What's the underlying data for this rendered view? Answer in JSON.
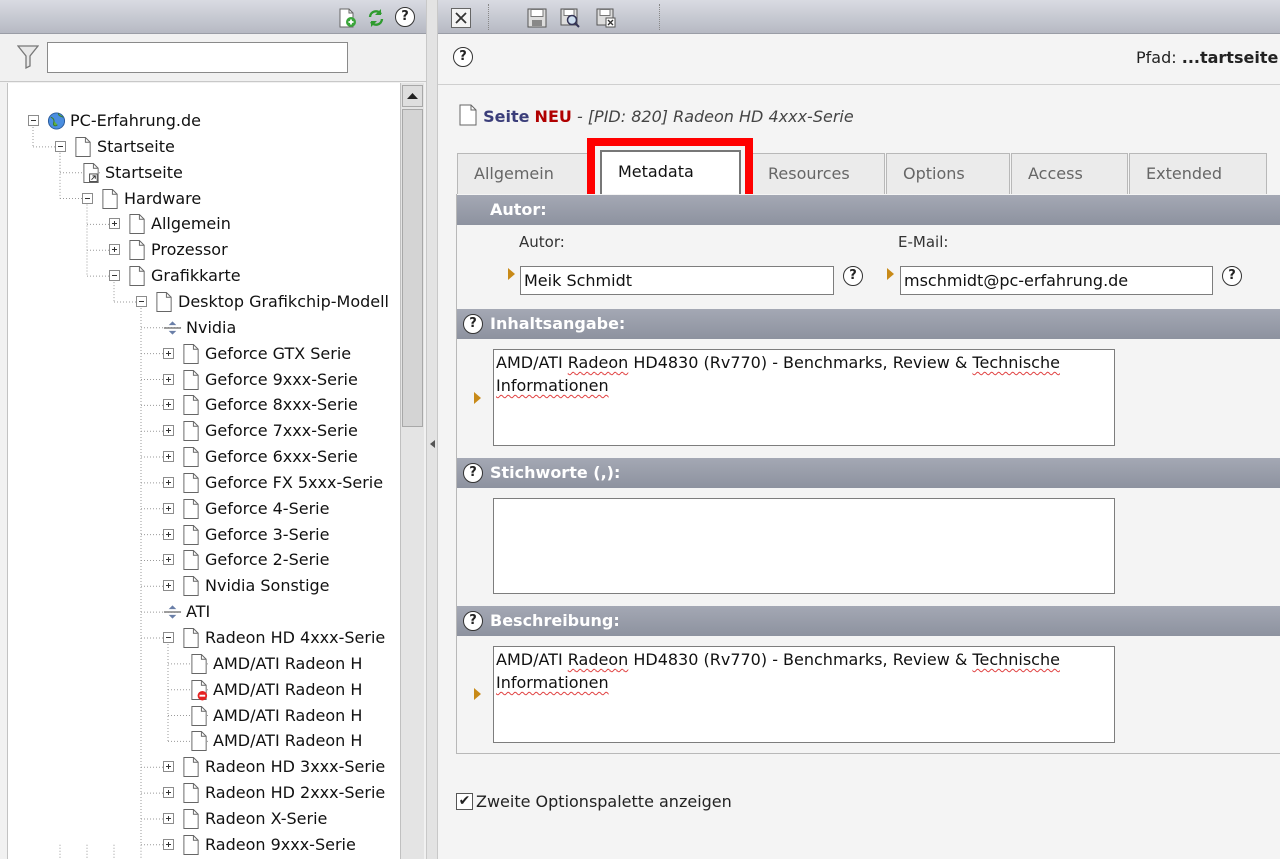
{
  "left_toolbar": {
    "icons": [
      "new-page-icon",
      "refresh-icon",
      "help-icon"
    ]
  },
  "filter": {
    "value": "",
    "placeholder": ""
  },
  "tree": [
    {
      "label": "PC-Erfahrung.de",
      "icon": "globe"
    },
    {
      "label": "Startseite",
      "icon": "page"
    },
    {
      "label": "Startseite",
      "icon": "link-page"
    },
    {
      "label": "Hardware",
      "icon": "page"
    },
    {
      "label": "Allgemein",
      "icon": "page"
    },
    {
      "label": "Prozessor",
      "icon": "page"
    },
    {
      "label": "Grafikkarte",
      "icon": "page"
    },
    {
      "label": "Desktop Grafikchip-Modell",
      "icon": "page"
    },
    {
      "label": "Nvidia",
      "icon": "separator"
    },
    {
      "label": "Geforce GTX Serie",
      "icon": "page"
    },
    {
      "label": "Geforce 9xxx-Serie",
      "icon": "page"
    },
    {
      "label": "Geforce 8xxx-Serie",
      "icon": "page"
    },
    {
      "label": "Geforce 7xxx-Serie",
      "icon": "page"
    },
    {
      "label": "Geforce 6xxx-Serie",
      "icon": "page"
    },
    {
      "label": "Geforce FX 5xxx-Serie",
      "icon": "page"
    },
    {
      "label": "Geforce 4-Serie",
      "icon": "page"
    },
    {
      "label": "Geforce 3-Serie",
      "icon": "page"
    },
    {
      "label": "Geforce 2-Serie",
      "icon": "page"
    },
    {
      "label": "Nvidia Sonstige",
      "icon": "page"
    },
    {
      "label": "ATI",
      "icon": "separator"
    },
    {
      "label": "Radeon HD 4xxx-Serie",
      "icon": "page"
    },
    {
      "label": "AMD/ATI Radeon H",
      "icon": "page"
    },
    {
      "label": "AMD/ATI Radeon H",
      "icon": "page-hidden"
    },
    {
      "label": "AMD/ATI Radeon H",
      "icon": "page"
    },
    {
      "label": "AMD/ATI Radeon H",
      "icon": "page"
    },
    {
      "label": "Radeon HD 3xxx-Serie",
      "icon": "page"
    },
    {
      "label": "Radeon HD 2xxx-Serie",
      "icon": "page"
    },
    {
      "label": "Radeon X-Serie",
      "icon": "page"
    },
    {
      "label": "Radeon 9xxx-Serie",
      "icon": "page"
    }
  ],
  "right_toolbar": {
    "icons": [
      "close-icon",
      "save-icon",
      "save-view-icon",
      "save-close-icon"
    ]
  },
  "pfad": {
    "label": "Pfad:",
    "value": "...tartseite"
  },
  "doc_title": {
    "prefix": "Seite",
    "status": "NEU",
    "rest": " - [PID: 820] Radeon HD 4xxx-Serie"
  },
  "tabs": [
    {
      "label": "Allgemein",
      "active": false
    },
    {
      "label": "Metadata",
      "active": true
    },
    {
      "label": "Resources",
      "active": false
    },
    {
      "label": "Options",
      "active": false
    },
    {
      "label": "Access",
      "active": false
    },
    {
      "label": "Extended",
      "active": false
    }
  ],
  "sections": {
    "author_head": "Autor:",
    "author_label": "Autor:",
    "author_value": "Meik Schmidt",
    "email_label": "E-Mail:",
    "email_value": "mschmidt@pc-erfahrung.de",
    "abstract_head": "Inhaltsangabe:",
    "abstract_line1_a": "AMD/ATI ",
    "abstract_line1_b": "Radeon",
    "abstract_line1_c": " HD4830 (Rv770) - Benchmarks, Review & ",
    "abstract_line1_d": "Technische",
    "abstract_line2": "Informationen",
    "keywords_head": "Stichworte (,):",
    "description_head": "Beschreibung:",
    "desc_line1_a": "AMD/ATI ",
    "desc_line1_b": "Radeon",
    "desc_line1_c": " HD4830 (Rv770) - Benchmarks, Review & ",
    "desc_line1_d": "Technische",
    "desc_line2": "Informationen"
  },
  "checkbox": {
    "label": "Zweite Optionspalette anzeigen",
    "checked": true
  },
  "colors": {
    "accent_red": "#ff0000",
    "title_blue": "#3b3e7a",
    "neu_red": "#b00000",
    "section_bg": "#979ba7",
    "marker": "#c88a18"
  }
}
